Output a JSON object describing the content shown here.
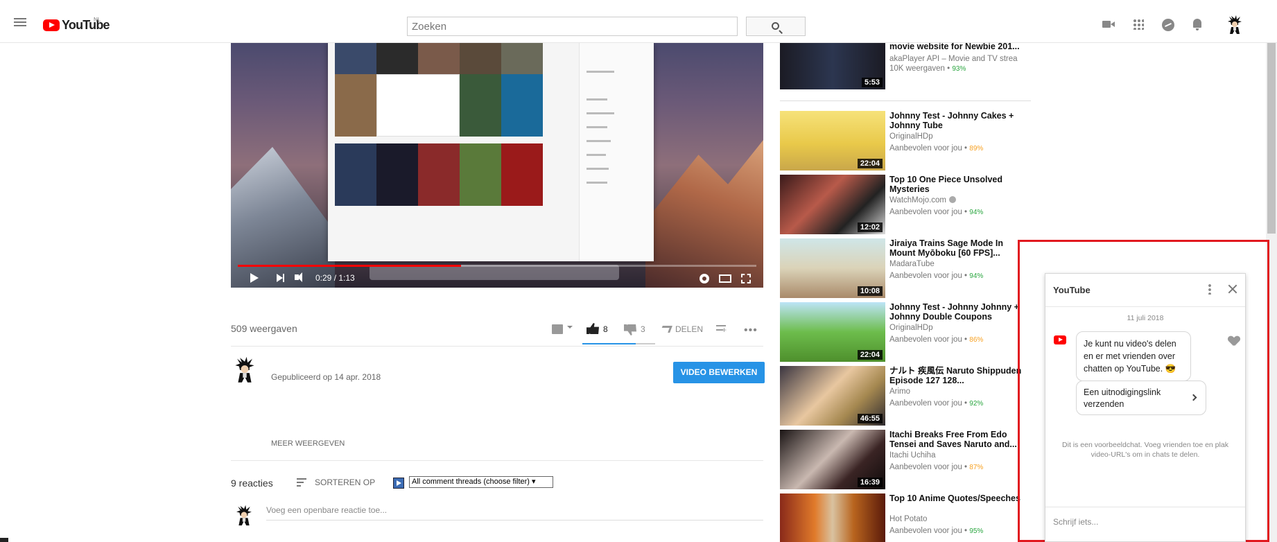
{
  "header": {
    "logo_text": "YouTube",
    "region": "NL",
    "search_placeholder": "Zoeken"
  },
  "player": {
    "time": "0:29 / 1:13",
    "progress": 0.43
  },
  "video": {
    "views": "509 weergaven",
    "likes": "8",
    "dislikes": "3",
    "share_label": "DELEN",
    "like_ratio": 0.73,
    "published": "Gepubliceerd op 14 apr. 2018",
    "edit_button": "VIDEO BEWERKEN",
    "show_more": "MEER WEERGEVEN"
  },
  "comments": {
    "count": "9 reacties",
    "sort_label": "SORTEREN OP",
    "filter_value": "All comment threads (choose filter) ▾",
    "placeholder": "Voeg een openbare reactie toe..."
  },
  "recommendations": [
    {
      "title": "movie website for Newbie 201...",
      "channel": "akaPlayer API – Movie and TV strea",
      "views": "10K weergaven",
      "pct": "93%",
      "pct_color": "green",
      "duration": "5:53"
    },
    {
      "title": "Johnny Test - Johnny Cakes + Johnny Tube",
      "channel": "OriginalHDp",
      "views": "Aanbevolen voor jou",
      "pct": "89%",
      "pct_color": "orange",
      "duration": "22:04"
    },
    {
      "title": "Top 10 One Piece Unsolved Mysteries",
      "channel": "WatchMojo.com",
      "views": "Aanbevolen voor jou",
      "pct": "94%",
      "pct_color": "green",
      "duration": "12:02"
    },
    {
      "title": "Jiraiya Trains Sage Mode In Mount Myōboku [60 FPS]...",
      "channel": "MadaraTube",
      "views": "Aanbevolen voor jou",
      "pct": "94%",
      "pct_color": "green",
      "duration": "10:08"
    },
    {
      "title": "Johnny Test - Johnny Johnny + Johnny Double Coupons",
      "channel": "OriginalHDp",
      "views": "Aanbevolen voor jou",
      "pct": "86%",
      "pct_color": "orange",
      "duration": "22:04"
    },
    {
      "title": "ナルト 疾風伝 Naruto Shippuden Episode 127 128...",
      "channel": "Arimo",
      "views": "Aanbevolen voor jou",
      "pct": "92%",
      "pct_color": "green",
      "duration": "46:55"
    },
    {
      "title": "Itachi Breaks Free From Edo Tensei and Saves Naruto and...",
      "channel": "Itachi Uchiha",
      "views": "Aanbevolen voor jou",
      "pct": "87%",
      "pct_color": "orange",
      "duration": "16:39"
    },
    {
      "title": "Top 10 Anime Quotes/Speeches",
      "channel": "Hot Potato",
      "views": "Aanbevolen voor jou",
      "pct": "95%",
      "pct_color": "green",
      "duration": ""
    }
  ],
  "chat": {
    "title": "YouTube",
    "date": "11 juli 2018",
    "message": "Je kunt nu video's delen en er met vrienden over chatten op YouTube. 😎",
    "invite": "Een uitnodigingslink verzenden",
    "note": "Dit is een voorbeeldchat. Voeg vrienden toe en plak video-URL's om in chats te delen.",
    "input_placeholder": "Schrijf iets..."
  },
  "colors": {
    "brand_red": "#ff0000",
    "accent_blue": "#2793e6",
    "highlight_red": "#e1191f",
    "pct_green": "#2ba640",
    "pct_orange": "#f7a020"
  }
}
